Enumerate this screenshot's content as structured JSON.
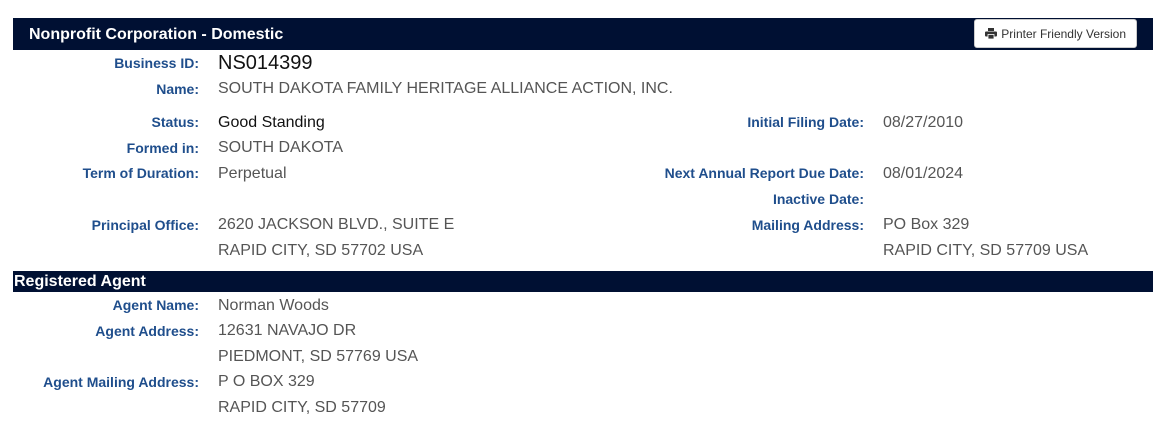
{
  "header": {
    "title": "Nonprofit Corporation - Domestic",
    "print_button": "Printer Friendly Version",
    "print_icon": "printer-icon"
  },
  "entity": {
    "business_id_label": "Business ID:",
    "business_id": "NS014399",
    "name_label": "Name:",
    "name": "SOUTH DAKOTA FAMILY HERITAGE ALLIANCE ACTION, INC.",
    "status_label": "Status:",
    "status": "Good Standing",
    "formed_in_label": "Formed in:",
    "formed_in": "SOUTH DAKOTA",
    "term_label": "Term of Duration:",
    "term": "Perpetual",
    "principal_office_label": "Principal Office:",
    "principal_office_line1": "2620 JACKSON BLVD., SUITE E",
    "principal_office_line2": "RAPID CITY, SD 57702 USA",
    "initial_filing_label": "Initial Filing Date:",
    "initial_filing": "08/27/2010",
    "next_report_label": "Next Annual Report Due Date:",
    "next_report": "08/01/2024",
    "inactive_label": "Inactive Date:",
    "inactive": "",
    "mailing_label": "Mailing Address:",
    "mailing_line1": "PO Box 329",
    "mailing_line2": "RAPID CITY, SD 57709 USA"
  },
  "agent": {
    "section_title": "Registered Agent",
    "name_label": "Agent Name:",
    "name": "Norman Woods",
    "address_label": "Agent Address:",
    "address_line1": "12631 NAVAJO DR",
    "address_line2": "PIEDMONT, SD 57769 USA",
    "mailing_label": "Agent Mailing Address:",
    "mailing_line1": "P O BOX 329",
    "mailing_line2": "RAPID CITY, SD 57709"
  }
}
